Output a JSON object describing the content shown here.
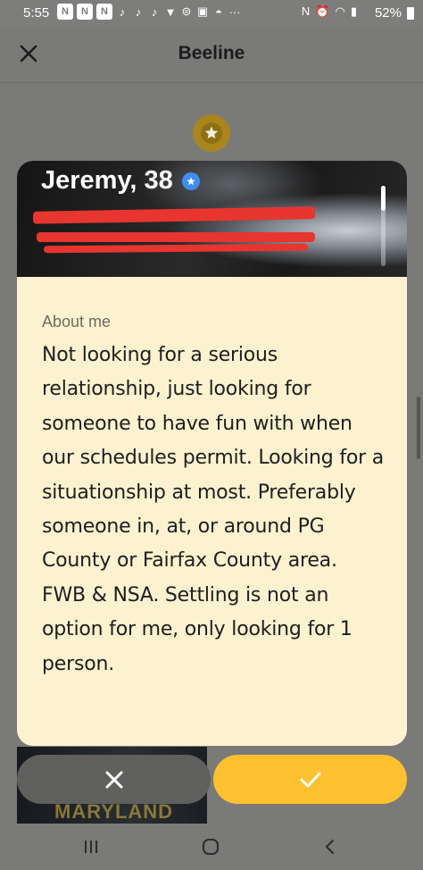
{
  "status_bar": {
    "time": "5:55",
    "battery_percent": "52%",
    "notification_icons": [
      "n",
      "n",
      "n",
      "♪",
      "♪",
      "♪",
      "🐦",
      "⎘",
      "🖼",
      "🍲",
      "···"
    ]
  },
  "header": {
    "title": "Beeline",
    "close_icon": "close-icon"
  },
  "badge": {
    "icon": "star-icon",
    "color": "#a8861c"
  },
  "profile": {
    "name_age": "Jeremy, 38",
    "verified": true,
    "about_heading": "About me",
    "about_text": "Not looking for a serious relationship, just looking for someone to have fun with when our schedules permit. Looking for a situationship at most. Preferably someone in, at, or around PG County or Fairfax County area. FWB & NSA. Settling is not an option for me, only looking for 1 person."
  },
  "next_photo_text": "MARYLAND",
  "actions": {
    "pass_icon": "close-icon",
    "like_icon": "check-icon"
  },
  "colors": {
    "accent_yellow": "#fdc12f",
    "card_background": "#fdf2d0",
    "verified_blue": "#3e8df5",
    "redaction_red": "#e8352f"
  }
}
